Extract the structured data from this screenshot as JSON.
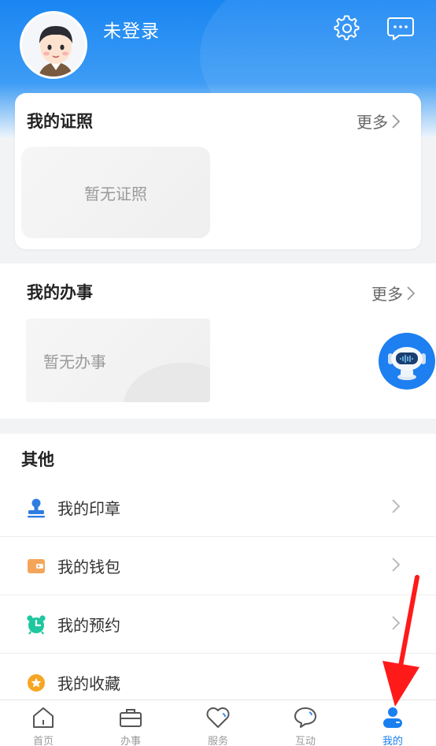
{
  "header": {
    "user_name": "未登录",
    "settings_icon": "gear-icon",
    "message_icon": "chat-bubble-icon"
  },
  "licenses": {
    "title": "我的证照",
    "more_label": "更多",
    "empty_text": "暂无证照"
  },
  "affairs": {
    "title": "我的办事",
    "more_label": "更多",
    "empty_text": "暂无办事"
  },
  "others": {
    "title": "其他",
    "items": [
      {
        "label": "我的印章",
        "icon": "stamp-icon",
        "color": "#2f7de1"
      },
      {
        "label": "我的钱包",
        "icon": "wallet-icon",
        "color": "#f5a55a"
      },
      {
        "label": "我的预约",
        "icon": "alarm-clock-icon",
        "color": "#1fc7a0"
      },
      {
        "label": "我的收藏",
        "icon": "star-icon",
        "color": "#f6a623"
      }
    ]
  },
  "tabbar": {
    "items": [
      {
        "label": "首页",
        "icon": "home-icon"
      },
      {
        "label": "办事",
        "icon": "briefcase-icon"
      },
      {
        "label": "服务",
        "icon": "heart-icon"
      },
      {
        "label": "互动",
        "icon": "speech-bubble-icon"
      },
      {
        "label": "我的",
        "icon": "person-icon",
        "active": true
      }
    ]
  },
  "colors": {
    "primary": "#1a7ff0",
    "annotation_arrow": "#ff1a1a"
  }
}
